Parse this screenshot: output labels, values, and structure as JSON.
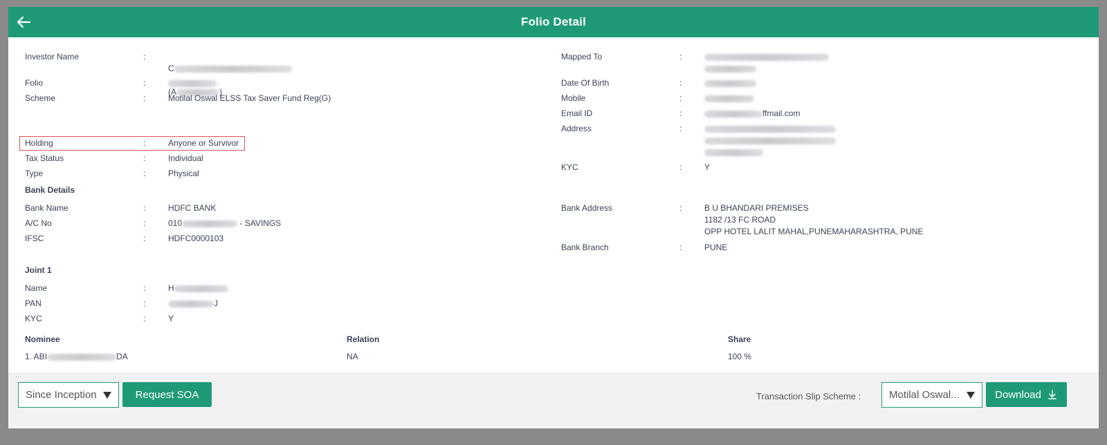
{
  "modal": {
    "title": "Folio Detail"
  },
  "investor": {
    "name_label": "Investor Name",
    "name_visible": "C",
    "name_line2_open": "(A",
    "name_line2_close": ")",
    "folio_label": "Folio",
    "scheme_label": "Scheme",
    "scheme_value": "Motilal Oswal ELSS Tax Saver Fund Reg(G)",
    "holding_label": "Holding",
    "holding_value": "Anyone or Survivor",
    "tax_status_label": "Tax Status",
    "tax_status_value": "Individual",
    "type_label": "Type",
    "type_value": "Physical"
  },
  "right_info": {
    "mapped_to_label": "Mapped To",
    "dob_label": "Date Of Birth",
    "mobile_label": "Mobile",
    "email_label": "Email ID",
    "email_visible_suffix": "ffmail.com",
    "address_label": "Address",
    "kyc_label": "KYC",
    "kyc_value": "Y"
  },
  "bank": {
    "section_title": "Bank Details",
    "bank_name_label": "Bank Name",
    "bank_name_value": "HDFC BANK",
    "acno_label": "A/C No",
    "acno_prefix": "010",
    "acno_suffix": " - SAVINGS",
    "ifsc_label": "IFSC",
    "ifsc_value": "HDFC0000103",
    "address_label": "Bank Address",
    "address_line1": "B U BHANDARI PREMISES",
    "address_line2": "1182 /13 FC ROAD",
    "address_line3": "OPP HOTEL LALIT MAHAL,PUNEMAHARASHTRA, PUNE",
    "branch_label": "Bank Branch",
    "branch_value": "PUNE"
  },
  "joint": {
    "section_title": "Joint 1",
    "name_label": "Name",
    "name_visible": "H",
    "pan_label": "PAN",
    "pan_visible_suffix": "J",
    "kyc_label": "KYC",
    "kyc_value": "Y"
  },
  "nominee": {
    "head_nominee": "Nominee",
    "head_relation": "Relation",
    "head_share": "Share",
    "row_name_prefix": "1. ABI",
    "row_name_suffix": "DA",
    "row_relation": "NA",
    "row_share": "100 %"
  },
  "footer": {
    "period_select_value": "Since Inception",
    "request_soa_label": "Request SOA",
    "transaction_slip_label": "Transaction Slip Scheme :",
    "scheme_select_value": "Motilal Oswal...",
    "download_label": "Download"
  },
  "colon": ":",
  "colors": {
    "accent": "#1f9a78",
    "highlight_border": "#e05252"
  }
}
